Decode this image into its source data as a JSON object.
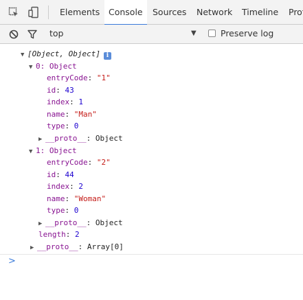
{
  "tabs": [
    {
      "label": "Elements"
    },
    {
      "label": "Console"
    },
    {
      "label": "Sources"
    },
    {
      "label": "Network"
    },
    {
      "label": "Timeline"
    },
    {
      "label": "Profi"
    }
  ],
  "toolbar": {
    "context": "top",
    "preserve_log": "Preserve log"
  },
  "console": {
    "array_summary": "[Object, Object]",
    "info_badge": "i",
    "items": [
      {
        "header": "0: Object",
        "fields": [
          {
            "key": "entryCode",
            "value": "\"1\""
          },
          {
            "key": "id",
            "value": "43"
          },
          {
            "key": "index",
            "value": "1"
          },
          {
            "key": "name",
            "value": "\"Man\""
          },
          {
            "key": "type",
            "value": "0"
          }
        ],
        "proto": {
          "key": "__proto__",
          "value": "Object"
        }
      },
      {
        "header": "1: Object",
        "fields": [
          {
            "key": "entryCode",
            "value": "\"2\""
          },
          {
            "key": "id",
            "value": "44"
          },
          {
            "key": "index",
            "value": "2"
          },
          {
            "key": "name",
            "value": "\"Woman\""
          },
          {
            "key": "type",
            "value": "0"
          }
        ],
        "proto": {
          "key": "__proto__",
          "value": "Object"
        }
      }
    ],
    "length": {
      "key": "length",
      "value": "2"
    },
    "array_proto": {
      "key": "__proto__",
      "value": "Array[0]"
    },
    "prompt": ">"
  }
}
